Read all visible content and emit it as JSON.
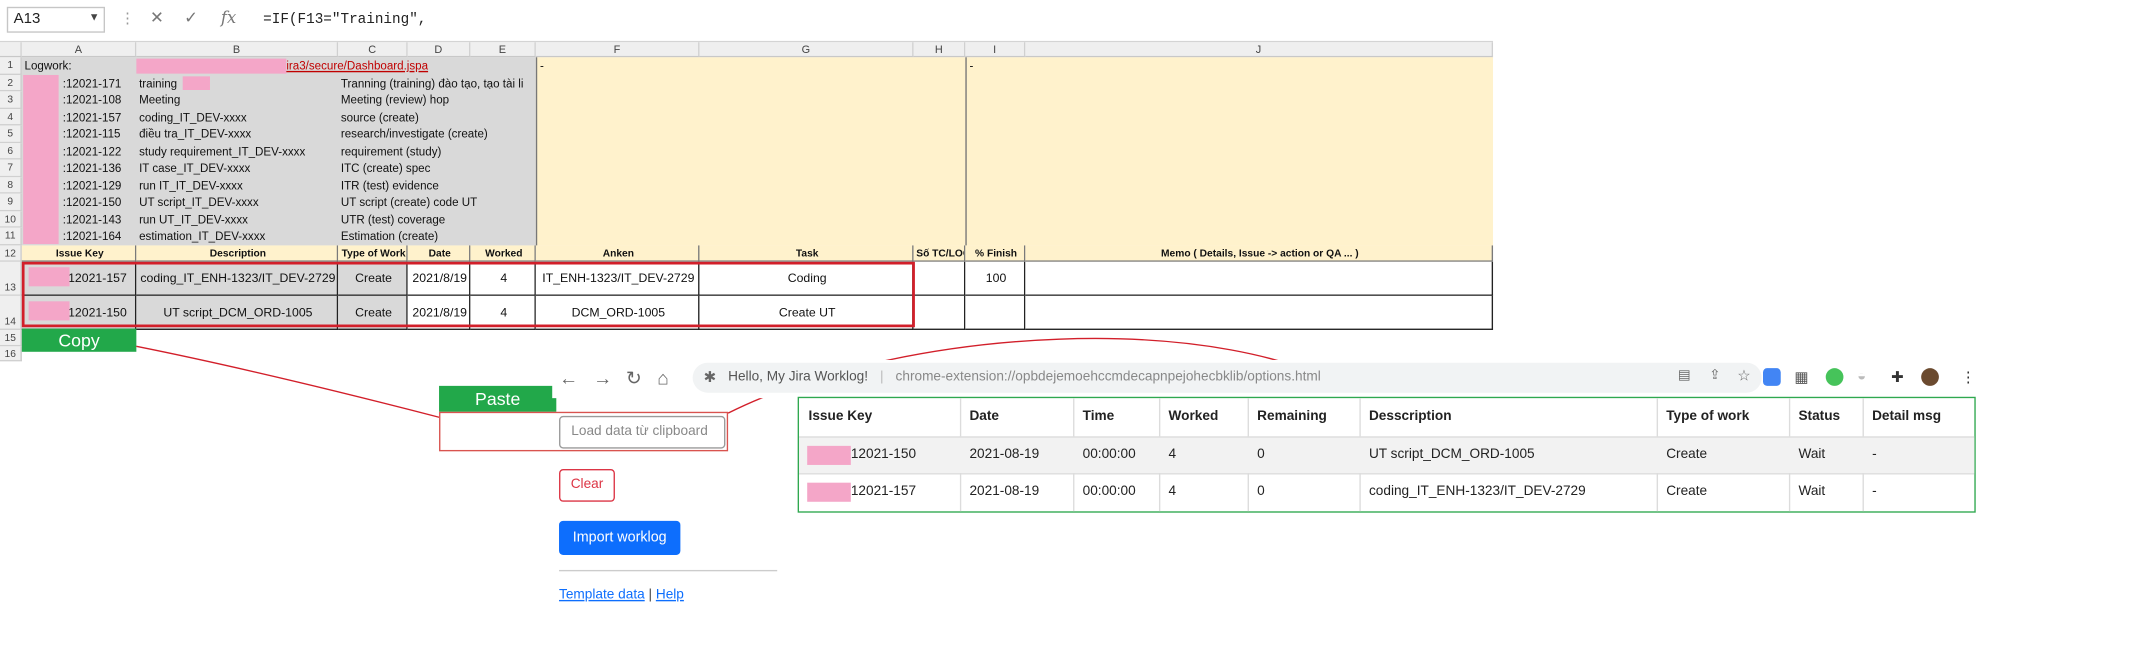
{
  "excel": {
    "name_box": "A13",
    "formula": "=IF(F13=\"Training\",",
    "columns": [
      "A",
      "B",
      "C",
      "D",
      "E",
      "F",
      "G",
      "H",
      "I",
      "J"
    ],
    "rows": [
      "1",
      "2",
      "3",
      "4",
      "5",
      "6",
      "7",
      "8",
      "9",
      "10",
      "11",
      "12",
      "13",
      "14",
      "15",
      "16"
    ],
    "logwork_label": "Logwork:",
    "dashboard_link": "ira3/secure/Dashboard.jspa",
    "dash_f": "-",
    "dash_i": "-",
    "task_rows": [
      {
        "key": ":12021-171",
        "name": "training",
        "desc": "Tranning (training) đào tạo, tạo tài li"
      },
      {
        "key": ":12021-108",
        "name": "Meeting",
        "desc": "Meeting (review) hop"
      },
      {
        "key": ":12021-157",
        "name": "coding_IT_DEV-xxxx",
        "desc": "source (create)"
      },
      {
        "key": ":12021-115",
        "name": "điều tra_IT_DEV-xxxx",
        "desc": "research/investigate (create)"
      },
      {
        "key": ":12021-122",
        "name": "study requirement_IT_DEV-xxxx",
        "desc": "requirement (study)"
      },
      {
        "key": ":12021-136",
        "name": "IT case_IT_DEV-xxxx",
        "desc": "ITC (create) spec"
      },
      {
        "key": ":12021-129",
        "name": "run IT_IT_DEV-xxxx",
        "desc": "ITR (test) evidence"
      },
      {
        "key": ":12021-150",
        "name": "UT script_IT_DEV-xxxx",
        "desc": "UT script (create) code UT"
      },
      {
        "key": ":12021-143",
        "name": "run UT_IT_DEV-xxxx",
        "desc": "UTR (test) coverage"
      },
      {
        "key": ":12021-164",
        "name": "estimation_IT_DEV-xxxx",
        "desc": "Estimation (create)"
      }
    ],
    "headers": [
      "Issue Key",
      "Description",
      "Type of Work",
      "Date",
      "Worked",
      "Anken",
      "Task",
      "Số TC/LOC",
      "% Finish",
      "Memo ( Details, Issue -> action  or QA ... )"
    ],
    "data_rows": [
      {
        "key": "12021-157",
        "desc": "coding_IT_ENH-1323/IT_DEV-2729",
        "type": "Create",
        "date": "2021/8/19",
        "worked": "4",
        "anken": "IT_ENH-1323/IT_DEV-2729",
        "task": "Coding",
        "loc": "",
        "finish": "100",
        "memo": ""
      },
      {
        "key": "12021-150",
        "desc": "UT script_DCM_ORD-1005",
        "type": "Create",
        "date": "2021/8/19",
        "worked": "4",
        "anken": "DCM_ORD-1005",
        "task": "Create UT",
        "loc": "",
        "finish": "",
        "memo": ""
      }
    ]
  },
  "annotations": {
    "copy_label": "Copy",
    "paste_label": "Paste"
  },
  "browser": {
    "page_title": "Hello, My Jira Worklog!",
    "url": "chrome-extension://opbdejemoehccmdecapnpejohecbklib/options.html"
  },
  "extension": {
    "load_placeholder": "Load data từ clipboard",
    "clear_label": "Clear",
    "import_label": "Import worklog",
    "template_link": "Template data",
    "link_separator": "|",
    "help_link": "Help",
    "table_headers": [
      "Issue Key",
      "Date",
      "Time",
      "Worked",
      "Remaining",
      "Desscription",
      "Type of work",
      "Status",
      "Detail msg"
    ],
    "table_rows": [
      {
        "key": "12021-150",
        "date": "2021-08-19",
        "time": "00:00:00",
        "worked": "4",
        "remaining": "0",
        "desc": "UT script_DCM_ORD-1005",
        "type": "Create",
        "status": "Wait",
        "msg": "-"
      },
      {
        "key": "12021-157",
        "date": "2021-08-19",
        "time": "00:00:00",
        "worked": "4",
        "remaining": "0",
        "desc": "coding_IT_ENH-1323/IT_DEV-2729",
        "type": "Create",
        "status": "Wait",
        "msg": "-"
      }
    ]
  },
  "colors": {
    "redaction": "#f4a6c8",
    "highlight_red": "#d21f2a",
    "annotation_green": "#22a84a",
    "table_border_green": "#2fa84f",
    "primary_blue": "#0d6efd"
  }
}
